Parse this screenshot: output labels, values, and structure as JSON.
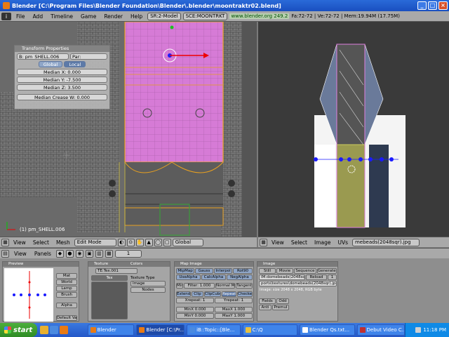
{
  "window": {
    "title": "Blender [C:\\Program Files\\Blender Foundation\\Blender\\.blender\\moontraktr02.blend]",
    "controls": [
      "_",
      "□",
      "×"
    ]
  },
  "top_header": {
    "menus": [
      "File",
      "Add",
      "Timeline",
      "Game",
      "Render",
      "Help"
    ],
    "screen": "SR:2-Model",
    "scene": "SCE:MOONTRKT",
    "website": "www.blender.org 249.2",
    "stats": "Fa:72-72 | Ve:72-72 | Mem:19.94M (17.75M)"
  },
  "transform_panel": {
    "title": "Transform Properties",
    "object_name": "B: pm_SHELL.006",
    "parent": "Par:",
    "global_label": "Global",
    "local_label": "Local",
    "median_x": "Median X: 0.000",
    "median_y": "Median Y: -7.500",
    "median_z": "Median Z: 3.500",
    "median_crease": "Median Crease W: 0.000"
  },
  "viewport3d": {
    "object_label": "(1) pm_SHELL.006"
  },
  "view3d_header": {
    "menus": [
      "View",
      "Select",
      "Mesh"
    ],
    "mode": "Edit Mode",
    "orientation": "Global"
  },
  "uv_header": {
    "menus": [
      "View",
      "Select",
      "Image",
      "UVs"
    ],
    "image_name": "mebeads(2048sqr).jpg"
  },
  "buttons_header": {
    "menus": [
      "View"
    ],
    "panels_label": "Panels",
    "frame": "1"
  },
  "preview_panel": {
    "title": "Preview",
    "buttons": [
      "Mat",
      "World",
      "Lamp",
      "Brush",
      "Alpha",
      "Default Vars"
    ]
  },
  "texture_panel": {
    "title": "Texture",
    "colors_tab": "Colors",
    "tex_name": "TE:Tex.001",
    "tex_slot": "Tex",
    "texture_type_label": "Texture Type",
    "texture_type": "Image",
    "nodes": "Nodes"
  },
  "map_image_panel": {
    "title": "Map Image",
    "tabs": [
      "MipMap",
      "Gauss",
      "Interpol",
      "Rot90"
    ],
    "row2": [
      "UseAlpha",
      "CalcAlpha",
      "NegAlpha"
    ],
    "min_label": "Min",
    "filter": "Filter: 1.000",
    "normal_map": "Normal Map",
    "tangent": "Tangent",
    "row4": [
      "Extend",
      "Clip",
      "ClipCube",
      "Repeat",
      "Checker"
    ],
    "xrepeat": "Xrepeat: 1",
    "yrepeat": "Yrepeat: 1",
    "minx": "MinX 0.000",
    "maxx": "MaxX 1.000",
    "miny": "MinY 0.000",
    "maxy": "MaxY 1.000"
  },
  "image_panel": {
    "title": "Image",
    "tabs": [
      "Still",
      "Movie",
      "Sequence",
      "Generated"
    ],
    "image_name": "IM:domebeads(2048sqr).jpg",
    "reload": "Reload",
    "users": "1",
    "path": "ports\\textures\\domebeads(2048sqr).jpg",
    "info": "Image: size 2048 x 2048, RGB byte",
    "fields": "Fields",
    "odd": "Odd",
    "anti": "Anti",
    "premul": "Premul"
  },
  "taskbar": {
    "start": "start",
    "tasks": [
      "Blender",
      "Blender [C:\\Pr...",
      "iB::Topic::[Ble...",
      "C:\\Q",
      "Blender Qs.txt...",
      "Debut Video C..."
    ],
    "active_task": 1,
    "clock": "11:18 PM"
  },
  "colors": {
    "title_blue": "#1a4fc0",
    "face_pink": "#d67bd6",
    "face_yellow": "#d6d670",
    "vertex_blue": "#1a1aff",
    "taskbar_blue": "#2458c8"
  }
}
